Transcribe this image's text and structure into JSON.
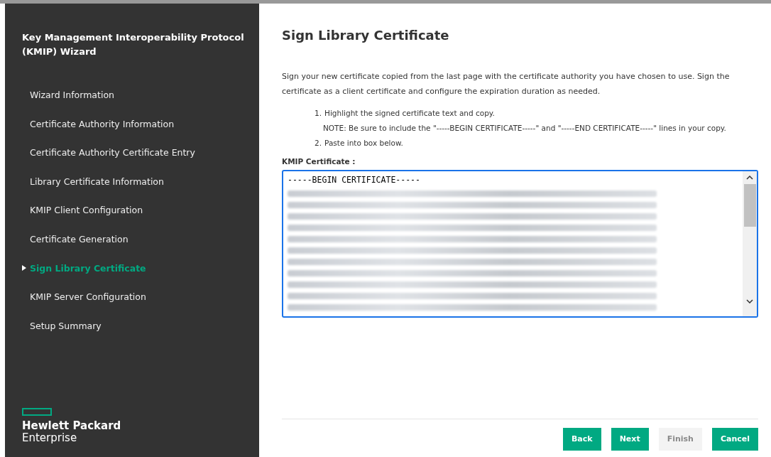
{
  "sidebar": {
    "title": "Key Management Interoperability Protocol (KMIP) Wizard",
    "items": [
      {
        "label": "Wizard Information",
        "selected": false
      },
      {
        "label": "Certificate Authority Information",
        "selected": false
      },
      {
        "label": "Certificate Authority Certificate Entry",
        "selected": false
      },
      {
        "label": "Library Certificate Information",
        "selected": false
      },
      {
        "label": "KMIP Client Configuration",
        "selected": false
      },
      {
        "label": "Certificate Generation",
        "selected": false
      },
      {
        "label": "Sign Library Certificate",
        "selected": true
      },
      {
        "label": "KMIP Server Configuration",
        "selected": false
      },
      {
        "label": "Setup Summary",
        "selected": false
      }
    ],
    "logo": {
      "line_1": "Hewlett Packard",
      "line_2": "Enterprise"
    }
  },
  "page": {
    "title": "Sign Library Certificate",
    "intro": "Sign your new certificate copied from the last page with the certificate authority you have chosen to use. Sign the certificate as a client certificate and configure the expiration duration as needed.",
    "steps": [
      {
        "number": "1.",
        "text": "Highlight the signed certificate text and copy.",
        "note": "NOTE: Be sure to include the \"-----BEGIN CERTIFICATE-----\" and \"-----END CERTIFICATE-----\" lines in your copy."
      },
      {
        "number": "2.",
        "text": "Paste into box below."
      }
    ],
    "field_label": "KMIP Certificate :",
    "certificate_value": "-----BEGIN CERTIFICATE-----"
  },
  "buttons": [
    {
      "label": "Back",
      "disabled": false
    },
    {
      "label": "Next",
      "disabled": false
    },
    {
      "label": "Finish",
      "disabled": true
    },
    {
      "label": "Cancel",
      "disabled": false
    }
  ]
}
